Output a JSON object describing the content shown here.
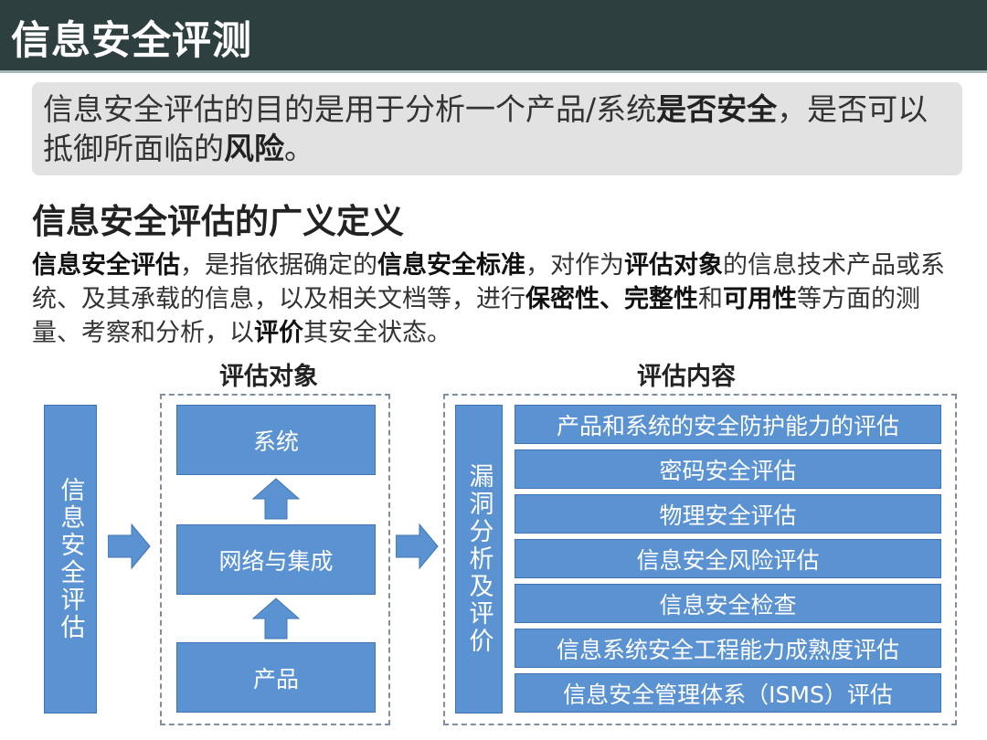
{
  "title": "信息安全评测",
  "intro": {
    "part1": "信息安全评估的目的是用于分析一个产品/系统",
    "bold1": "是否安全",
    "part2": "，是否可以抵御所面临的",
    "bold2": "风险",
    "part3": "。"
  },
  "subtitle": "信息安全评估的广义定义",
  "definition": [
    {
      "text": "信息安全评估",
      "bold": true
    },
    {
      "text": "，是指依据确定的",
      "bold": false
    },
    {
      "text": "信息安全标准",
      "bold": true
    },
    {
      "text": "，对作为",
      "bold": false
    },
    {
      "text": "评估对象",
      "bold": true
    },
    {
      "text": "的信息技术产品或系统、及其承载的信息，以及相关文档等，进行",
      "bold": false
    },
    {
      "text": "保密性、完整性",
      "bold": true
    },
    {
      "text": "和",
      "bold": false
    },
    {
      "text": "可用性",
      "bold": true
    },
    {
      "text": "等方面的测量、考察和分析，以",
      "bold": false
    },
    {
      "text": "评价",
      "bold": true
    },
    {
      "text": "其安全状态。",
      "bold": false
    }
  ],
  "diagram": {
    "header_objects": "评估对象",
    "header_contents": "评估内容",
    "left_box": "信息安全评估",
    "objects": [
      "系统",
      "网络与集成",
      "产品"
    ],
    "middle_box": "漏洞分析及评价",
    "contents": [
      "产品和系统的安全防护能力的评估",
      "密码安全评估",
      "物理安全评估",
      "信息安全风险评估",
      "信息安全检查",
      "信息系统安全工程能力成熟度评估",
      "信息安全管理体系（ISMS）评估"
    ],
    "colors": {
      "box": "#5b92d2",
      "border": "#3e74b4",
      "title_bar": "#2e3f3f"
    }
  }
}
